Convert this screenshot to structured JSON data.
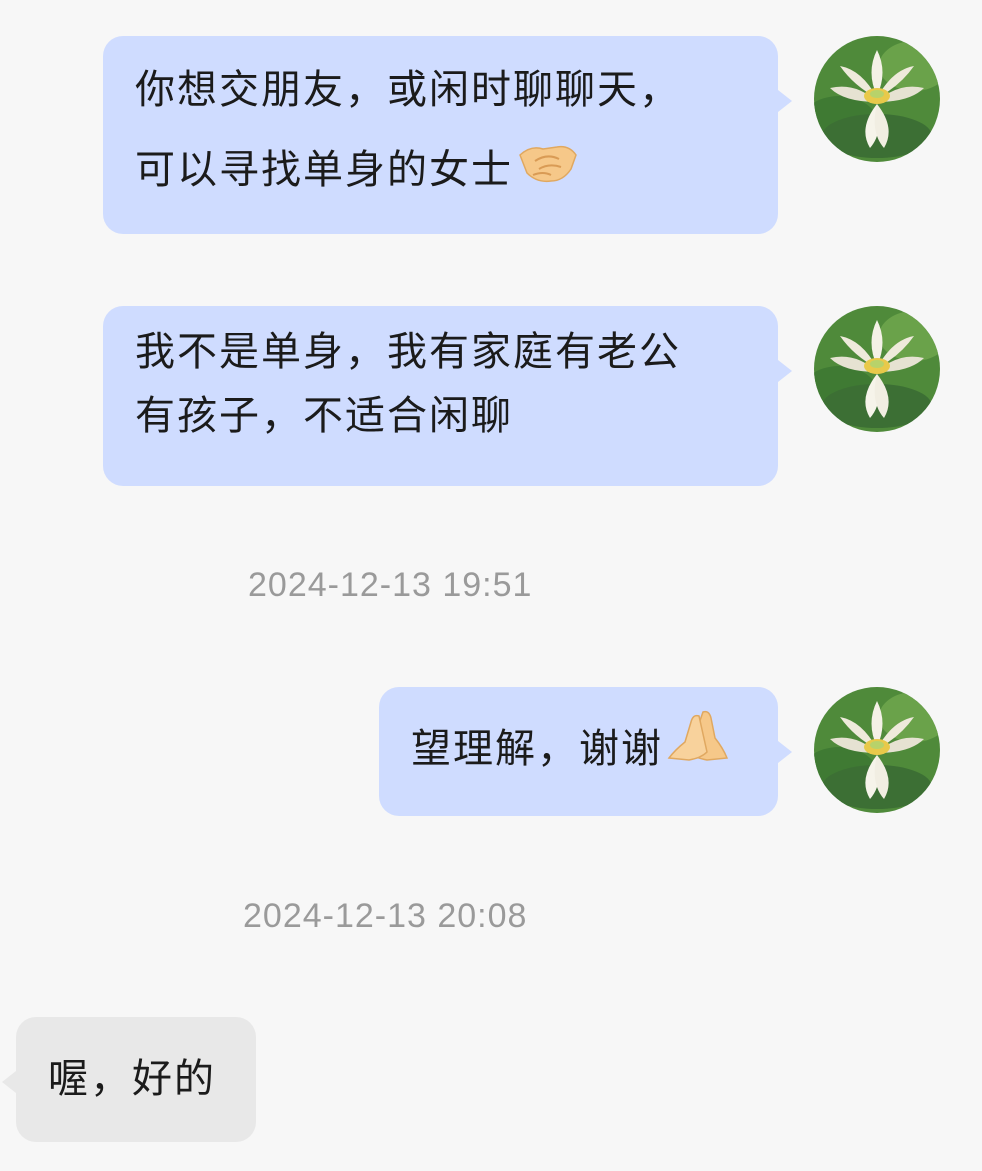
{
  "messages": [
    {
      "side": "out",
      "lines": [
        "你想交朋友，或闲时聊聊天，",
        "可以寻找单身的女士"
      ],
      "emoji": "handshake-emoji"
    },
    {
      "side": "out",
      "lines": [
        "我不是单身，我有家庭有老公",
        "有孩子，不适合闲聊"
      ]
    },
    {
      "side": "out",
      "lines": [
        "望理解，谢谢"
      ],
      "emoji": "folded-hands-emoji"
    },
    {
      "side": "in",
      "lines": [
        "喔，好的"
      ]
    }
  ],
  "timestamps": [
    "2024-12-13 19:51",
    "2024-12-13 20:08"
  ],
  "avatar": {
    "icon": "lotus-flower-avatar"
  },
  "colors": {
    "background": "#f7f7f7",
    "outgoing_bubble": "#cfdcff",
    "incoming_bubble": "#e8e8e8",
    "timestamp_text": "#9a9a9a"
  }
}
